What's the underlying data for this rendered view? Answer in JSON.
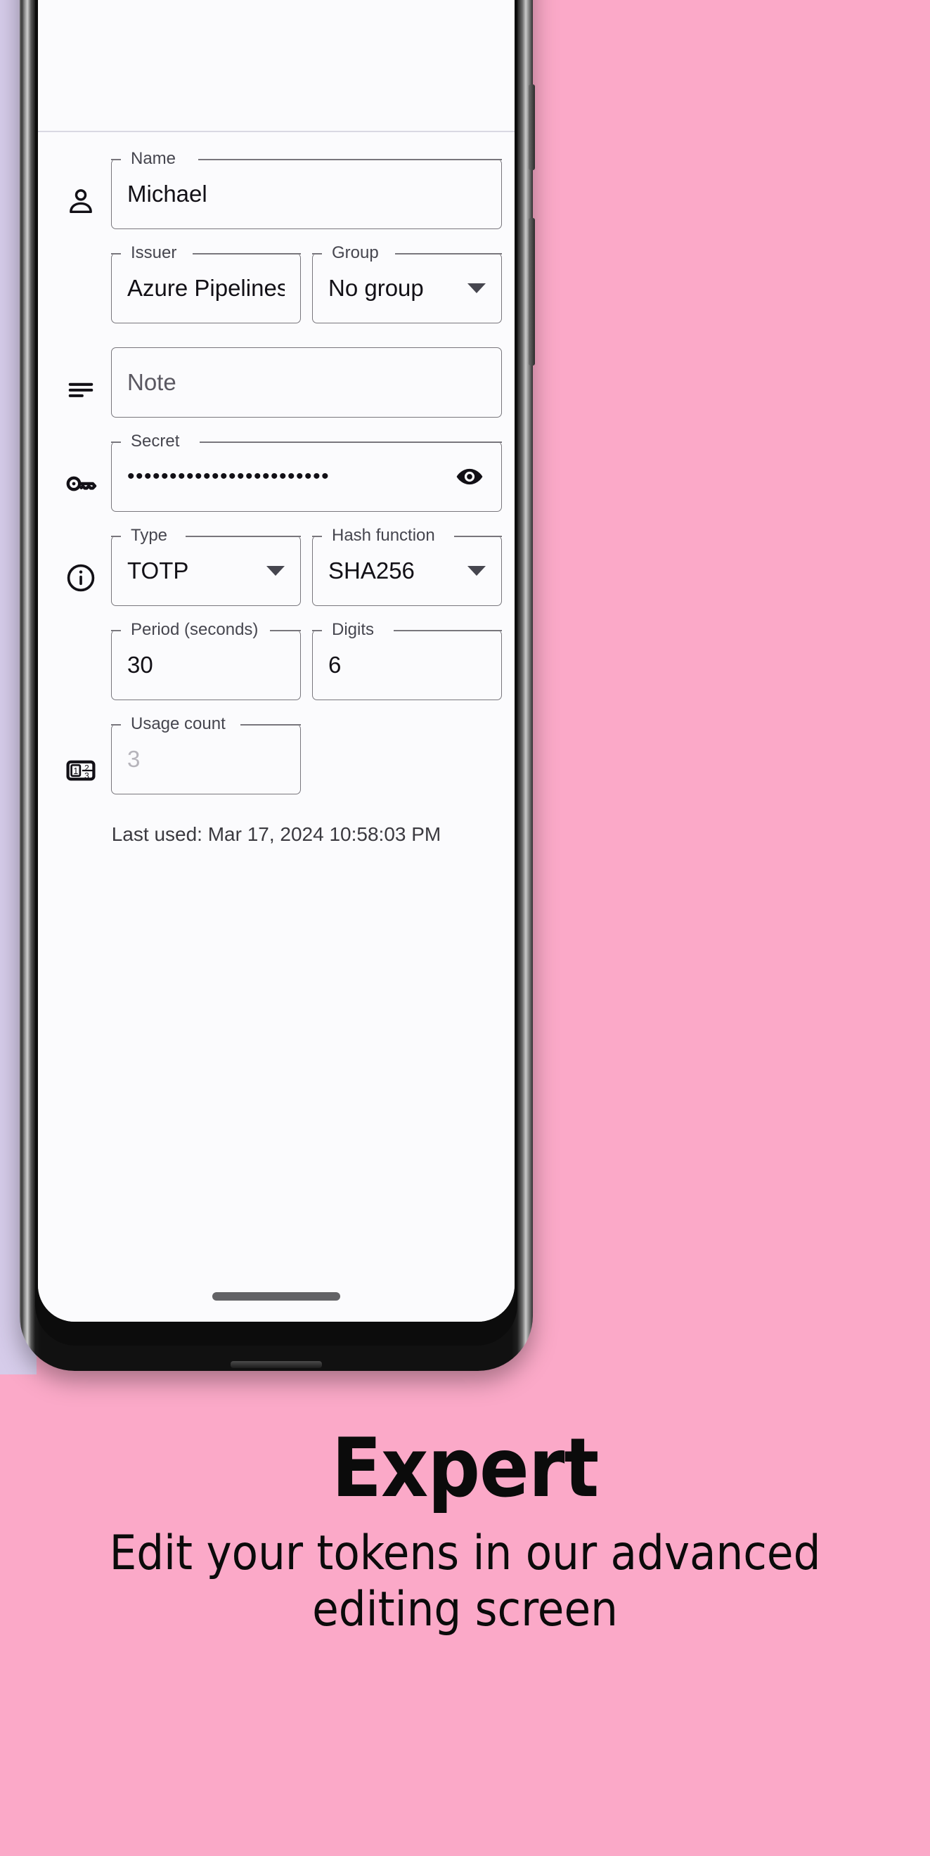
{
  "theme": {
    "page_background": "#FBA9C8",
    "left_strip": "#D6CCEA",
    "screen_background": "#FBFBFD",
    "brand_blue": "#1F57DB",
    "field_outline": "#78767C",
    "label_color": "#46464F",
    "value_color": "#121016",
    "disabled_value": "#B6B4BB"
  },
  "app": {
    "brand_logo_name": "app-logo",
    "form": {
      "rows": [
        {
          "icon": "person-icon",
          "fields": [
            {
              "name": "name-field",
              "label": "Name",
              "value": "Michael",
              "kind": "text"
            }
          ]
        },
        {
          "icon": "none",
          "fields": [
            {
              "name": "issuer-field",
              "label": "Issuer",
              "value": "Azure Pipelines",
              "kind": "text"
            },
            {
              "name": "group-field",
              "label": "Group",
              "value": "No group",
              "kind": "dropdown"
            }
          ]
        },
        {
          "icon": "notes-icon",
          "fields": [
            {
              "name": "note-field",
              "label": "",
              "value": "Note",
              "kind": "placeholder"
            }
          ]
        },
        {
          "icon": "key-icon",
          "fields": [
            {
              "name": "secret-field",
              "label": "Secret",
              "value": "••••••••••••••••••••••••",
              "kind": "password"
            }
          ]
        },
        {
          "icon": "info-icon",
          "fields": [
            {
              "name": "type-field",
              "label": "Type",
              "value": "TOTP",
              "kind": "dropdown"
            },
            {
              "name": "hash-function-field",
              "label": "Hash function",
              "value": "SHA256",
              "kind": "dropdown"
            }
          ]
        },
        {
          "icon": "none",
          "fields": [
            {
              "name": "period-field",
              "label": "Period (seconds)",
              "value": "30",
              "kind": "text"
            },
            {
              "name": "digits-field",
              "label": "Digits",
              "value": "6",
              "kind": "text"
            }
          ]
        },
        {
          "icon": "counter-icon",
          "fields": [
            {
              "name": "usage-count-field",
              "label": "Usage count",
              "value": "3",
              "kind": "disabled"
            }
          ]
        }
      ],
      "labels": {
        "name": "Name",
        "issuer": "Issuer",
        "group": "Group",
        "note_placeholder": "Note",
        "secret": "Secret",
        "secret_masked": "••••••••••••••••••••••••",
        "type": "Type",
        "hash_function": "Hash function",
        "period": "Period (seconds)",
        "digits": "Digits",
        "usage_count": "Usage count"
      },
      "values": {
        "name": "Michael",
        "issuer": "Azure Pipelines",
        "group": "No group",
        "type": "TOTP",
        "hash_function": "SHA256",
        "period": "30",
        "digits": "6",
        "usage_count": "3"
      }
    },
    "last_used": "Last used: Mar 17, 2024 10:58:03 PM"
  },
  "promo": {
    "title": "Expert",
    "subtitle": "Edit your tokens in our advanced editing screen"
  }
}
